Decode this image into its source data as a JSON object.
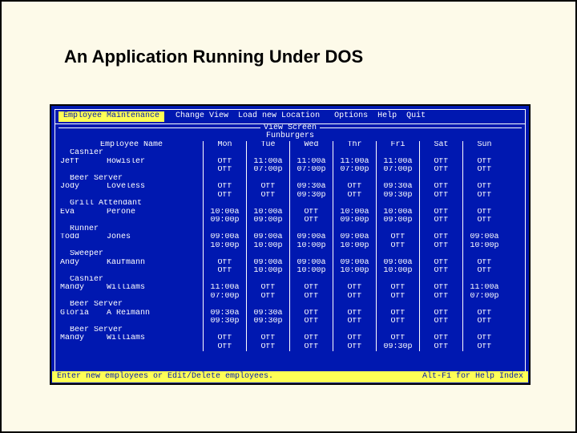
{
  "slide": {
    "title": "An Application Running Under DOS"
  },
  "menu": {
    "items": [
      {
        "label": "Employee Maintenance",
        "active": true
      },
      {
        "label": "Change View",
        "active": false
      },
      {
        "label": "Load new Location",
        "active": false
      },
      {
        "label": "Options",
        "active": false
      },
      {
        "label": "Help",
        "active": false
      },
      {
        "label": "Quit",
        "active": false
      }
    ]
  },
  "panel": {
    "title": "View Screen",
    "subtitle": "Funburgers",
    "name_header": "Employee Name",
    "days": [
      "Mon",
      "Tue",
      "Wed",
      "Thr",
      "Fri",
      "Sat",
      "Sun"
    ]
  },
  "rows": [
    {
      "type": "role",
      "label": "Cashier"
    },
    {
      "type": "emp",
      "first": "Jeff",
      "last": "Howisler",
      "cells": [
        "Off",
        "11:00a",
        "11:00a",
        "11:00a",
        "11:00a",
        "Off",
        "Off"
      ]
    },
    {
      "type": "emp",
      "first": "",
      "last": "",
      "cells": [
        "Off",
        "07:00p",
        "07:00p",
        "07:00p",
        "07:00p",
        "Off",
        "Off"
      ]
    },
    {
      "type": "role",
      "label": "Beer Server"
    },
    {
      "type": "emp",
      "first": "Jody",
      "last": "Loveless",
      "cells": [
        "Off",
        "Off",
        "09:30a",
        "Off",
        "09:30a",
        "Off",
        "Off"
      ]
    },
    {
      "type": "emp",
      "first": "",
      "last": "",
      "cells": [
        "Off",
        "Off",
        "09:30p",
        "Off",
        "09:30p",
        "Off",
        "Off"
      ]
    },
    {
      "type": "role",
      "label": "Grill Attendant"
    },
    {
      "type": "emp",
      "first": "Eva",
      "last": "Perone",
      "cells": [
        "10:00a",
        "10:00a",
        "Off",
        "10:00a",
        "10:00a",
        "Off",
        "Off"
      ]
    },
    {
      "type": "emp",
      "first": "",
      "last": "",
      "cells": [
        "09:00p",
        "09:00p",
        "Off",
        "09:00p",
        "09:00p",
        "Off",
        "Off"
      ]
    },
    {
      "type": "role",
      "label": "Runner"
    },
    {
      "type": "emp",
      "first": "Todd",
      "last": "Jones",
      "cells": [
        "09:00a",
        "09:00a",
        "09:00a",
        "09:00a",
        "Off",
        "Off",
        "09:00a"
      ]
    },
    {
      "type": "emp",
      "first": "",
      "last": "",
      "cells": [
        "10:00p",
        "10:00p",
        "10:00p",
        "10:00p",
        "Off",
        "Off",
        "10:00p"
      ]
    },
    {
      "type": "role",
      "label": "Sweeper"
    },
    {
      "type": "emp",
      "first": "Andy",
      "last": "Kaufmann",
      "cells": [
        "Off",
        "09:00a",
        "09:00a",
        "09:00a",
        "09:00a",
        "Off",
        "Off"
      ]
    },
    {
      "type": "emp",
      "first": "",
      "last": "",
      "cells": [
        "Off",
        "10:00p",
        "10:00p",
        "10:00p",
        "10:00p",
        "Off",
        "Off"
      ]
    },
    {
      "type": "role",
      "label": "Cashier"
    },
    {
      "type": "emp",
      "first": "Mandy",
      "last": "Williams",
      "cells": [
        "11:00a",
        "Off",
        "Off",
        "Off",
        "Off",
        "Off",
        "11:00a"
      ]
    },
    {
      "type": "emp",
      "first": "",
      "last": "",
      "cells": [
        "07:00p",
        "Off",
        "Off",
        "Off",
        "Off",
        "Off",
        "07:00p"
      ]
    },
    {
      "type": "role",
      "label": "Beer Server"
    },
    {
      "type": "emp",
      "first": "Gloria",
      "last": "A Reimann",
      "cells": [
        "09:30a",
        "09:30a",
        "Off",
        "Off",
        "Off",
        "Off",
        "Off"
      ]
    },
    {
      "type": "emp",
      "first": "",
      "last": "",
      "cells": [
        "09:30p",
        "09:30p",
        "Off",
        "Off",
        "Off",
        "Off",
        "Off"
      ]
    },
    {
      "type": "role",
      "label": "Beer Server"
    },
    {
      "type": "emp",
      "first": "Mandy",
      "last": "Williams",
      "cells": [
        "Off",
        "Off",
        "Off",
        "Off",
        "Off",
        "Off",
        "Off"
      ]
    },
    {
      "type": "emp",
      "first": "",
      "last": "",
      "cells": [
        "Off",
        "Off",
        "Off",
        "Off",
        "09:30p",
        "Off",
        "Off"
      ]
    }
  ],
  "status": {
    "left": "Enter new employees or Edit/Delete employees.",
    "right": "Alt-F1 for Help Index"
  }
}
